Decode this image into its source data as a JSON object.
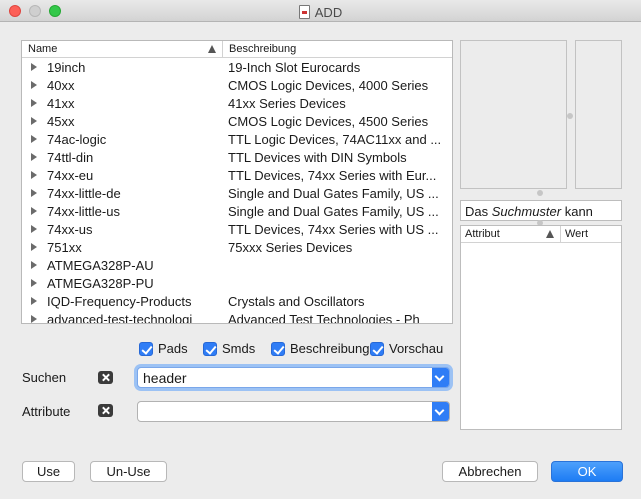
{
  "window": {
    "title": "ADD"
  },
  "library_list": {
    "columns": [
      "Name",
      "Beschreibung"
    ],
    "rows": [
      {
        "name": "19inch",
        "desc": "19-Inch Slot Eurocards"
      },
      {
        "name": "40xx",
        "desc": "CMOS Logic Devices, 4000 Series"
      },
      {
        "name": "41xx",
        "desc": "41xx Series Devices"
      },
      {
        "name": "45xx",
        "desc": "CMOS Logic Devices, 4500 Series"
      },
      {
        "name": "74ac-logic",
        "desc": "TTL Logic Devices, 74AC11xx and ..."
      },
      {
        "name": "74ttl-din",
        "desc": "TTL Devices with DIN Symbols"
      },
      {
        "name": "74xx-eu",
        "desc": "TTL Devices, 74xx Series with Eur..."
      },
      {
        "name": "74xx-little-de",
        "desc": "Single and Dual Gates Family, US ..."
      },
      {
        "name": "74xx-little-us",
        "desc": "Single and Dual Gates Family, US ..."
      },
      {
        "name": "74xx-us",
        "desc": "TTL Devices, 74xx Series with US ..."
      },
      {
        "name": "751xx",
        "desc": "75xxx Series Devices"
      },
      {
        "name": "ATMEGA328P-AU",
        "desc": ""
      },
      {
        "name": "ATMEGA328P-PU",
        "desc": ""
      },
      {
        "name": "IQD-Frequency-Products",
        "desc": "Crystals and Oscillators"
      },
      {
        "name": "advanced-test-technologi",
        "desc": "Advanced Test Technologies - Ph"
      }
    ]
  },
  "preview": {
    "search_hint_pre": "Das ",
    "search_hint_em": "Suchmuster",
    "search_hint_post": " kann"
  },
  "attributes_table": {
    "columns": [
      "Attribut",
      "Wert"
    ]
  },
  "options": {
    "pads": "Pads",
    "smds": "Smds",
    "beschreibung": "Beschreibung",
    "vorschau": "Vorschau"
  },
  "search": {
    "label": "Suchen",
    "value": "header"
  },
  "attribute": {
    "label": "Attribute",
    "value": ""
  },
  "buttons": {
    "use": "Use",
    "unuse": "Un-Use",
    "cancel": "Abbrechen",
    "ok": "OK"
  }
}
